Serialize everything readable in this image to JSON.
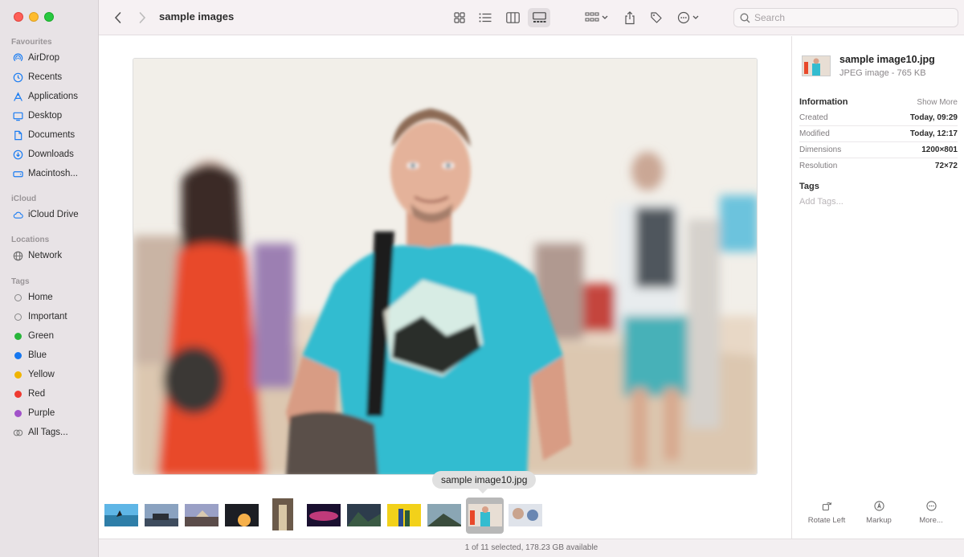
{
  "window": {
    "title": "sample images",
    "traffic_lights": [
      "close",
      "minimize",
      "zoom"
    ]
  },
  "sidebar": {
    "favourites_heading": "Favourites",
    "favourites": [
      {
        "label": "AirDrop",
        "icon": "airdrop-icon"
      },
      {
        "label": "Recents",
        "icon": "clock-icon"
      },
      {
        "label": "Applications",
        "icon": "applications-icon"
      },
      {
        "label": "Desktop",
        "icon": "desktop-icon"
      },
      {
        "label": "Documents",
        "icon": "document-icon"
      },
      {
        "label": "Downloads",
        "icon": "download-icon"
      },
      {
        "label": "Macintosh...",
        "icon": "disk-icon"
      }
    ],
    "icloud_heading": "iCloud",
    "icloud": [
      {
        "label": "iCloud Drive",
        "icon": "cloud-icon"
      }
    ],
    "locations_heading": "Locations",
    "locations": [
      {
        "label": "Network",
        "icon": "globe-icon"
      }
    ],
    "tags_heading": "Tags",
    "tags": [
      {
        "label": "Home",
        "color": "hollow"
      },
      {
        "label": "Important",
        "color": "hollow"
      },
      {
        "label": "Green",
        "color": "#28b53a"
      },
      {
        "label": "Blue",
        "color": "#1677f0"
      },
      {
        "label": "Yellow",
        "color": "#f0b400"
      },
      {
        "label": "Red",
        "color": "#ef3a30"
      },
      {
        "label": "Purple",
        "color": "#a152c9"
      },
      {
        "label": "All Tags...",
        "color": "alltags"
      }
    ],
    "accent_color": "#1a7cf2"
  },
  "toolbar": {
    "back": "chevron-left-icon",
    "forward": "chevron-right-icon",
    "view_modes": [
      "icon-view",
      "list-view",
      "column-view",
      "gallery-view"
    ],
    "active_view": "gallery-view",
    "group": "group-icon",
    "share": "share-icon",
    "tag": "tag-icon",
    "action": "ellipsis-circle-icon",
    "search_placeholder": "Search"
  },
  "gallery": {
    "tooltip": "sample image10.jpg",
    "thumbnail_count": 11,
    "selected_index": 9
  },
  "inspector": {
    "name": "sample image10.jpg",
    "kind": "JPEG image - 765 KB",
    "info_heading": "Information",
    "show_more": "Show More",
    "rows": [
      {
        "key": "Created",
        "value": "Today, 09:29"
      },
      {
        "key": "Modified",
        "value": "Today, 12:17"
      },
      {
        "key": "Dimensions",
        "value": "1200×801"
      },
      {
        "key": "Resolution",
        "value": "72×72"
      }
    ],
    "tags_heading": "Tags",
    "tags_placeholder": "Add Tags...",
    "actions": {
      "rotate": "Rotate Left",
      "markup": "Markup",
      "more": "More..."
    }
  },
  "status": {
    "text": "1 of 11 selected, 178.23 GB available"
  }
}
